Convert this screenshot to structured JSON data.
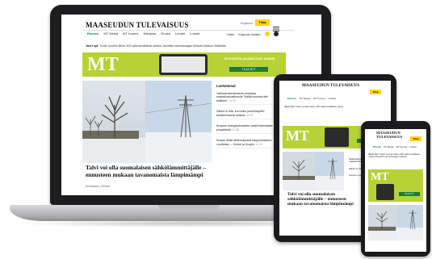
{
  "site": {
    "logo": "MAASEUDUN TULEVAISUUS",
    "subscribe": "Tilaa"
  },
  "laptop": {
    "top_right": "Kirjaudu",
    "nav": [
      "Etusivu",
      "MT Metsä",
      "MT Koneet",
      "Mielipide",
      "Ruoka",
      "Lehdet",
      "Luhdet"
    ],
    "nav_right": [
      "Haku",
      "Kirjaudu sisään"
    ],
    "ticker_label": "Juuri nyt:",
    "ticker_text": "Turkin tuontiin lähes 300 valkovenäläistä maitoa, siirrettiin varmistusajan tullauta Maitoon Mässälle",
    "banner_logo": "MT",
    "banner_text": "MT:N DIGITILAAJANA SAAT KAIKEN",
    "banner_button": "TILAA NYT",
    "sidebar_title": "Luetuimmat",
    "sidebar_items": [
      {
        "text": "Valtiovarainministeriö ehdottaa maataloushallinnolle \"Kaikki avointa alle kaikkien\"",
        "time": "14:32"
      },
      {
        "text": "Sähkö ei riitä, kun koko puhelinsyöttö keskeisimpinä hetkinä",
        "time": "13:05"
      },
      {
        "text": "Kuopion energiantuotanto vaatii toisenlaista ympäristöä",
        "time": "12:48"
      },
      {
        "text": "Kuopio lisäsi lähikumppanit kaupunkitaloon vuodessa — Koulut ja Kuopio",
        "time": "11:20"
      }
    ],
    "headline": "Talvi voi olla suomalaisen sähkölämmittäjälle – ennusteen mukaan tavanomaista lämpimämpi",
    "meta": "Kuvitukset | Tekstit"
  },
  "tablet": {
    "nav": [
      "Etusivu",
      "MT Metsä",
      "MT Koneet",
      "Lehdet"
    ],
    "ticker_label": "Juuri nyt:",
    "ticker_text": "Turkin tuontiin lähes 300 valkovenäläistä maitoa",
    "side_items": [
      "Valtiovarainministeriö ehdottaa maataloushallinnolle",
      "Sähkö ei riitä koko puhelinsyöttö",
      "Kuopion energiantuotanto vaatii"
    ],
    "headline": "Talvi voi olla suomalaisen sähkölämmittäjälle – ennusteen mukaan tavanomaista lämpimämpi"
  },
  "phone": {
    "nav": [
      "Etusivu",
      "MT Metsä",
      "MT Koneet",
      "Lehdet"
    ],
    "ticker_label": "Juuri nyt:",
    "ticker_text": "Turkin tuontiin lähes 300 valkovenäläistä maitoa siirrettiin varmistusajan tullauta"
  },
  "colors": {
    "brand_green": "#b6d236",
    "subscribe_yellow": "#ffd400",
    "device_black": "#1d1d1f",
    "laptop_silver": "#bdbec0"
  }
}
